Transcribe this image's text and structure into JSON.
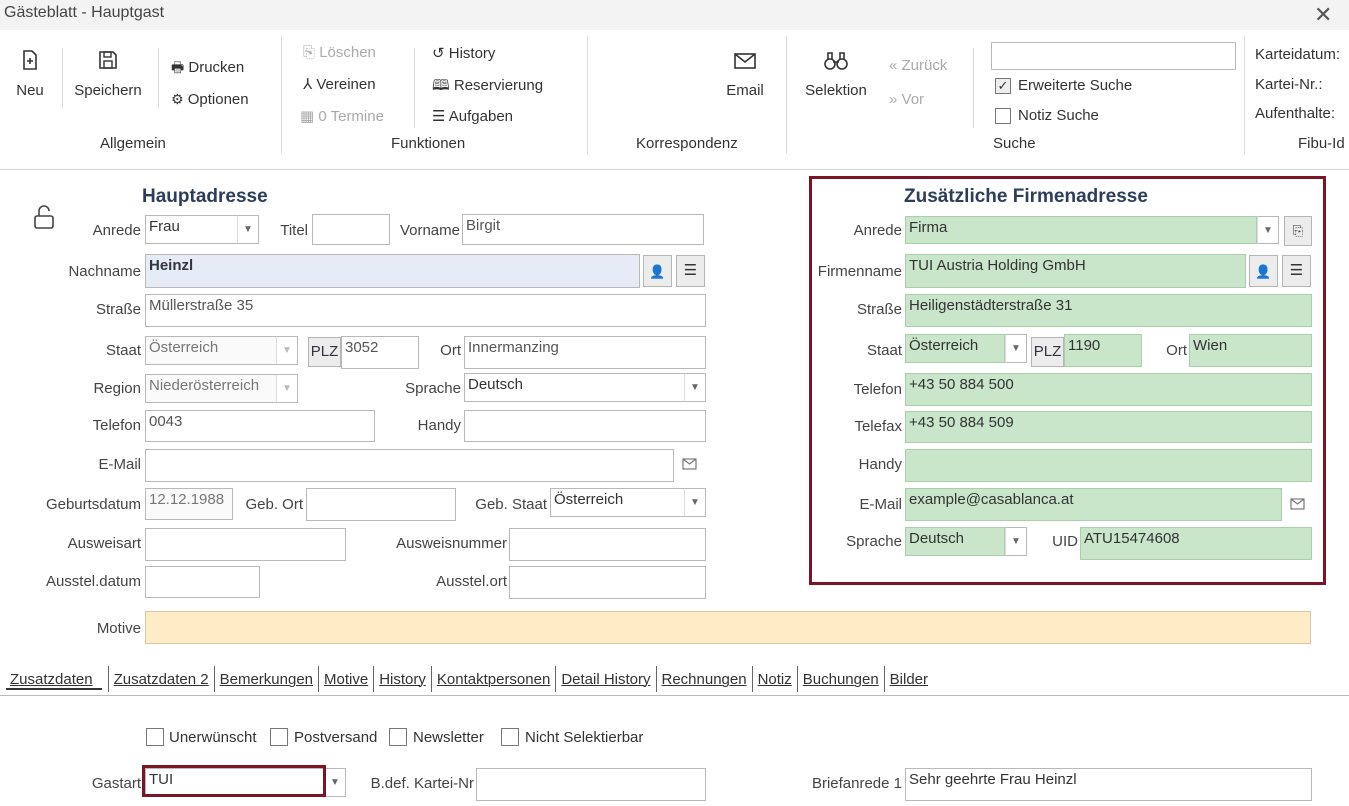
{
  "window": {
    "title": "Gästeblatt - Hauptgast",
    "close_glyph": "✕"
  },
  "ribbon": {
    "allgemein": {
      "group": "Allgemein",
      "neu": "Neu",
      "speichern": "Speichern",
      "drucken": "Drucken",
      "optionen": "Optionen"
    },
    "funktionen": {
      "group": "Funktionen",
      "loeschen": "Löschen",
      "vereinen": "Vereinen",
      "termine": "0 Termine",
      "history": "History",
      "reservierung": "Reservierung",
      "aufgaben": "Aufgaben"
    },
    "korrespondenz": {
      "group": "Korrespondenz",
      "email": "Email"
    },
    "suche": {
      "group": "Suche",
      "selektion": "Selektion",
      "zurueck": "Zurück",
      "vor": "Vor",
      "search_value": "",
      "erweiterte": "Erweiterte Suche",
      "erweiterte_checked": true,
      "notiz": "Notiz Suche",
      "notiz_checked": false
    },
    "fibu": {
      "group": "Fibu-Id",
      "karteidatum": "Karteidatum:",
      "kartei_nr": "Kartei-Nr.:",
      "aufenthalte": "Aufenthalte:"
    }
  },
  "haupt": {
    "heading": "Hauptadresse",
    "anrede_label": "Anrede",
    "anrede": "Frau",
    "titel_label": "Titel",
    "titel": "",
    "vorname_label": "Vorname",
    "vorname": "Birgit",
    "nachname_label": "Nachname",
    "nachname": "Heinzl",
    "strasse_label": "Straße",
    "strasse": "Müllerstraße 35",
    "staat_label": "Staat",
    "staat": "Österreich",
    "plz_button": "PLZ",
    "plz": "3052",
    "ort_label": "Ort",
    "ort": "Innermanzing",
    "region_label": "Region",
    "region": "Niederösterreich",
    "sprache_label": "Sprache",
    "sprache": "Deutsch",
    "telefon_label": "Telefon",
    "telefon": "0043",
    "handy_label": "Handy",
    "handy": "",
    "email_label": "E-Mail",
    "email": "",
    "geburtsdatum_label": "Geburtsdatum",
    "geburtsdatum": "12.12.1988",
    "gebort_label": "Geb. Ort",
    "gebort": "",
    "gebstaat_label": "Geb. Staat",
    "gebstaat": "Österreich",
    "ausweisart_label": "Ausweisart",
    "ausweisart": "",
    "ausweisnummer_label": "Ausweisnummer",
    "ausweisnummer": "",
    "ausstelldatum_label": "Ausstel.datum",
    "ausstelldatum": "",
    "ausstellort_label": "Ausstel.ort",
    "ausstellort": "",
    "motive_label": "Motive",
    "motive": ""
  },
  "firma": {
    "heading": "Zusätzliche Firmenadresse",
    "anrede_label": "Anrede",
    "anrede": "Firma",
    "firmenname_label": "Firmenname",
    "firmenname": "TUI Austria Holding GmbH",
    "strasse_label": "Straße",
    "strasse": "Heiligenstädterstraße 31",
    "staat_label": "Staat",
    "staat": "Österreich",
    "plz_button": "PLZ",
    "plz": "1190",
    "ort_label": "Ort",
    "ort": "Wien",
    "telefon_label": "Telefon",
    "telefon": "+43 50 884 500",
    "telefax_label": "Telefax",
    "telefax": "+43 50 884 509",
    "handy_label": "Handy",
    "handy": "",
    "email_label": "E-Mail",
    "email": "example@casablanca.at",
    "sprache_label": "Sprache",
    "sprache": "Deutsch",
    "uid_label": "UID",
    "uid": "ATU15474608",
    "highlight_color": "#7a1426"
  },
  "tabs": [
    "Zusatzdaten",
    "Zusatzdaten 2",
    "Bemerkungen",
    "Motive",
    "History",
    "Kontaktpersonen",
    "Detail History",
    "Rechnungen",
    "Notiz",
    "Buchungen",
    "Bilder"
  ],
  "zusatz": {
    "unerwuenscht": "Unerwünscht",
    "postversand": "Postversand",
    "newsletter": "Newsletter",
    "nicht_selektierbar": "Nicht Selektierbar",
    "gastart_label": "Gastart",
    "gastart": "TUI",
    "bdef_label": "B.def. Kartei-Nr",
    "bdef": "",
    "briefanrede_label": "Briefanrede 1",
    "briefanrede": "Sehr geehrte Frau Heinzl"
  }
}
